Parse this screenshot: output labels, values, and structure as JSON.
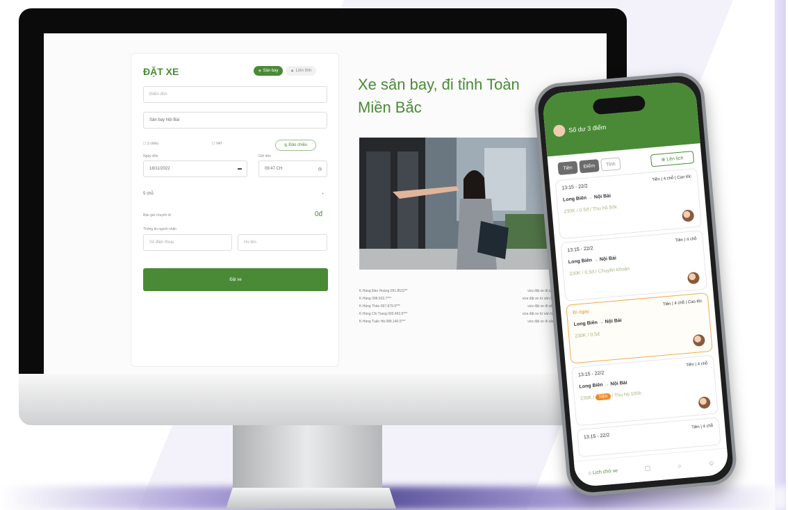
{
  "web": {
    "form": {
      "title": "ĐẶT XE",
      "tab_active": "Sân bay",
      "tab_other": "Liên tỉnh",
      "pickup_placeholder": "Điểm đón",
      "destination": "Sân bay Nội Bài",
      "two_way": "2 chiều",
      "vat": "VAT",
      "swap_label": "Đảo chiều",
      "date_label": "Ngày đón",
      "date_value": "18/11/2022",
      "time_label": "Giờ đón",
      "time_value": "09:47 CH",
      "seats": "5 chỗ",
      "price_label": "Báo giá chuyến đi",
      "price_value": "0đ",
      "contact_label": "Thông tin người nhận",
      "phone_placeholder": "Số điện thoại",
      "name_placeholder": "Họ tên",
      "submit": "Đặt xe"
    },
    "hero": {
      "headline_line1": "Xe sân bay, đi tỉnh Toàn",
      "headline_line2": "Miền Bắc"
    },
    "contacts": [
      {
        "left": "K.Hàng Đào Hoàng 091.8532**",
        "right": "vừa đặt xe đi sân bay"
      },
      {
        "left": "K.Hàng 098.932.7***",
        "right": "vừa đặt xe từ sân bay về"
      },
      {
        "left": "K.Hàng Thảo 097.879.9***",
        "right": "vừa đặt xe đi sân bay"
      },
      {
        "left": "K.Hàng Chi Trang 090.453.5***",
        "right": "vừa đặt xe từ sân bay về"
      },
      {
        "left": "K.Hàng Tuấn Hà 088.140.5***",
        "right": "vừa đặt xe đi sân bay"
      }
    ]
  },
  "phone": {
    "greeting": "Số dư 3 điểm",
    "tabs": [
      "Tiền",
      "Điểm",
      "Tỉnh"
    ],
    "schedule_button": "Lên lịch",
    "trips": [
      {
        "time": "13:15 - 22/2",
        "type": "Tiền | 4 chỗ | Cao tốc",
        "from": "Long Biên",
        "to": "Nội Bài",
        "price": "230K / 0.5đ / Thu hộ 50k",
        "badge": ""
      },
      {
        "time": "13:15 - 22/2",
        "type": "Tiền | 4 chỗ",
        "from": "Long Biên",
        "to": "Nội Bài",
        "price": "230K / 0.5đ / Chuyển khoản",
        "badge": ""
      },
      {
        "time": "Đi ngay",
        "type": "Tiền | 4 chỗ | Cao tốc",
        "from": "Long Biên",
        "to": "Nội Bài",
        "price": "230K / 0.5đ",
        "badge": ""
      },
      {
        "time": "13:15 - 22/2",
        "type": "Tiền | 4 chỗ",
        "from": "Long Biên",
        "to": "Nội Bài",
        "price": "230K / ",
        "badge": "Tiền",
        "price_tail": " / Thu hộ 100k"
      },
      {
        "time": "13:15 - 22/2",
        "type": "Tiền | 4 chỗ",
        "from": "",
        "to": "",
        "price": "",
        "badge": ""
      }
    ],
    "nav": [
      "Lịch chờ xe"
    ]
  },
  "colors": {
    "brand_green": "#4a8a37",
    "accent_orange": "#f2aa4a"
  }
}
